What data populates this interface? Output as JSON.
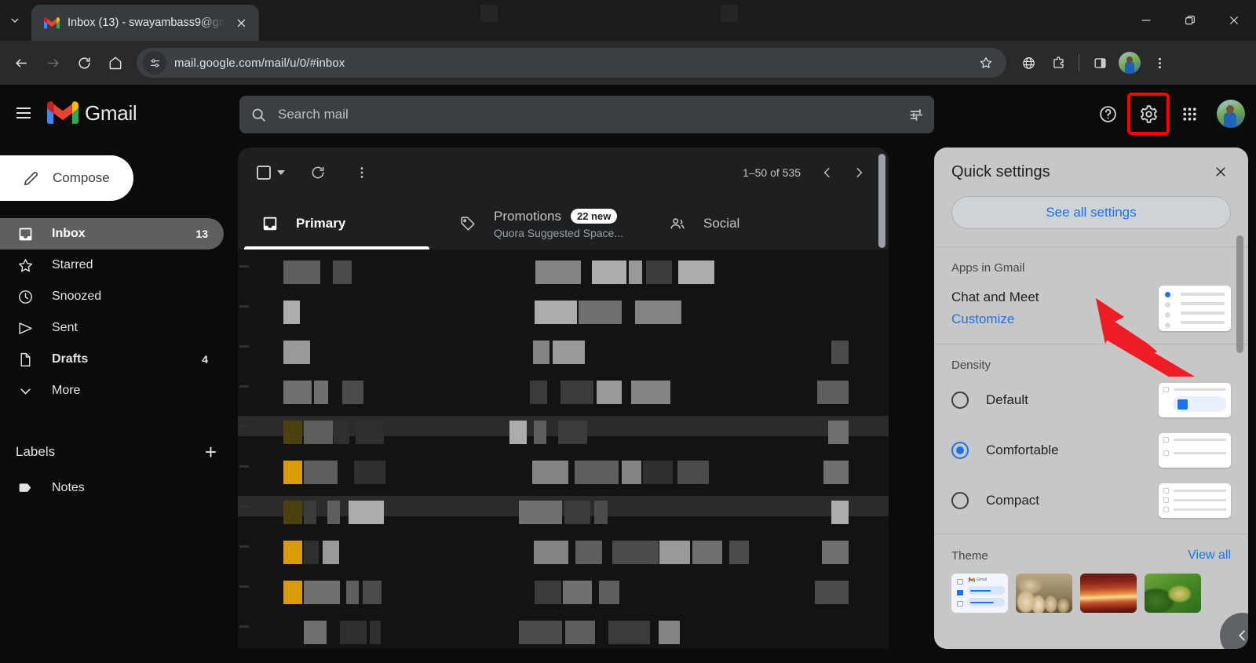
{
  "browser": {
    "tab": {
      "title": "Inbox (13) - swayambass9@gm",
      "favicon": "gmail-icon",
      "close": "×"
    },
    "window": {
      "minimize": "minimize-icon",
      "restore": "restore-icon",
      "close": "close-icon"
    },
    "nav": {
      "back": "back-icon",
      "forward": "forward-icon",
      "reload": "reload-icon",
      "home": "home-icon"
    },
    "omnibox": {
      "url": "mail.google.com/mail/u/0/#inbox",
      "site_info": "tune-icon",
      "bookmark": "star-icon"
    },
    "toolbar_icons": [
      "globe-icon",
      "extensions-icon",
      "side-panel-icon",
      "profile-avatar",
      "more-menu-icon"
    ]
  },
  "gmail": {
    "header": {
      "menu": "hamburger-icon",
      "brand": "Gmail",
      "search": {
        "placeholder": "Search mail",
        "value": "",
        "icon": "search-icon",
        "options_icon": "search-options-icon"
      },
      "help": "help-icon",
      "settings": "settings-gear-icon",
      "apps": "google-apps-icon",
      "account": "account-avatar"
    },
    "sidebar": {
      "compose": {
        "label": "Compose",
        "icon": "pencil-icon"
      },
      "items": [
        {
          "label": "Inbox",
          "count": "13",
          "icon": "inbox-icon",
          "active": true,
          "bold": true
        },
        {
          "label": "Starred",
          "count": "",
          "icon": "star-icon",
          "active": false,
          "bold": false
        },
        {
          "label": "Snoozed",
          "count": "",
          "icon": "clock-icon",
          "active": false,
          "bold": false
        },
        {
          "label": "Sent",
          "count": "",
          "icon": "send-icon",
          "active": false,
          "bold": false
        },
        {
          "label": "Drafts",
          "count": "4",
          "icon": "draft-icon",
          "active": false,
          "bold": true
        },
        {
          "label": "More",
          "count": "",
          "icon": "chevron-down-icon",
          "active": false,
          "bold": false
        }
      ],
      "labels": {
        "title": "Labels",
        "add": "+",
        "items": [
          {
            "label": "Notes",
            "icon": "label-icon"
          }
        ]
      }
    },
    "maillist": {
      "select_all": "select-all-checkbox",
      "refresh": "refresh-icon",
      "more": "more-vert-icon",
      "range": "1–50 of 535",
      "prev": "chevron-left-icon",
      "next": "chevron-right-icon",
      "tabs": [
        {
          "label": "Primary",
          "icon": "inbox-tab-icon",
          "badge": "",
          "subtitle": "",
          "active": true
        },
        {
          "label": "Promotions",
          "icon": "tag-tab-icon",
          "badge": "22 new",
          "subtitle": "Quora Suggested Space...",
          "active": false
        },
        {
          "label": "Social",
          "icon": "people-tab-icon",
          "badge": "",
          "subtitle": "",
          "active": false
        }
      ]
    },
    "quick_settings": {
      "title": "Quick settings",
      "close": "close-icon",
      "see_all": "See all settings",
      "apps_section": {
        "title": "Apps in Gmail",
        "row_label": "Chat and Meet",
        "link": "Customize",
        "thumb": "chat-meet-thumbnail"
      },
      "density_section": {
        "title": "Density",
        "options": [
          {
            "label": "Default",
            "selected": false,
            "thumb": "density-default-thumbnail"
          },
          {
            "label": "Comfortable",
            "selected": true,
            "thumb": "density-comfortable-thumbnail"
          },
          {
            "label": "Compact",
            "selected": false,
            "thumb": "density-compact-thumbnail"
          }
        ]
      },
      "theme_section": {
        "title": "Theme",
        "view_all": "View all",
        "thumbs": [
          "theme-default",
          "theme-chess",
          "theme-canyon",
          "theme-leaf"
        ]
      },
      "collapse_fab": "chevron-left-icon"
    }
  },
  "annotation": {
    "arrow": "red-arrow-pointing-to-see-all-settings",
    "color": "#ee1c25",
    "highlight_color": "#ff0000"
  }
}
